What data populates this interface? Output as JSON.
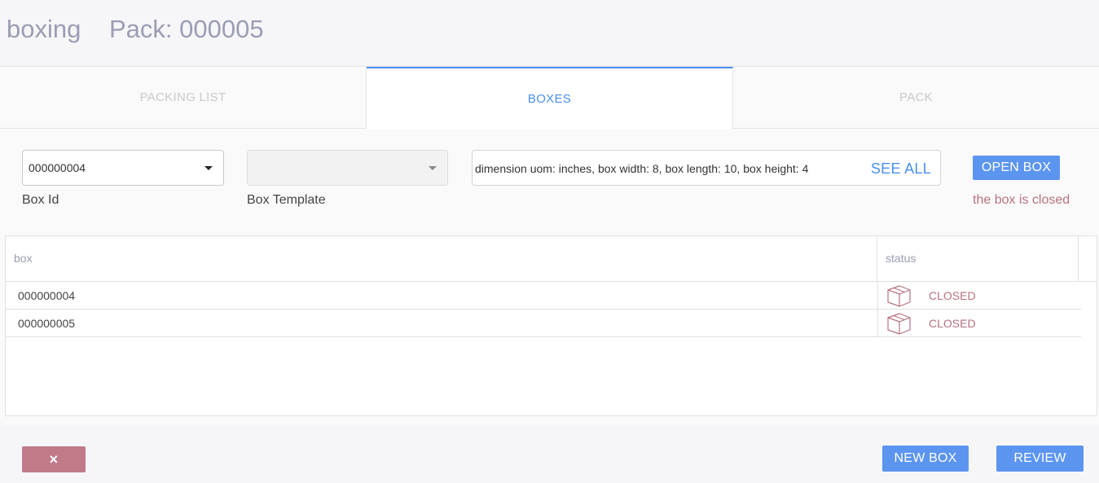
{
  "header": {
    "app_title": "boxing",
    "pack_title": "Pack: 000005"
  },
  "tabs": [
    {
      "label": "PACKING LIST",
      "active": false
    },
    {
      "label": "BOXES",
      "active": true
    },
    {
      "label": "PACK",
      "active": false
    }
  ],
  "form": {
    "box_id_value": "000000004",
    "box_id_label": "Box Id",
    "box_template_value": "",
    "box_template_label": "Box Template",
    "dimensions_text": "dimension uom: inches, box width: 8, box length: 10, box height: 4",
    "see_all_label": "SEE ALL",
    "open_box_label": "OPEN BOX",
    "box_status_message": "the box is closed"
  },
  "table": {
    "columns": [
      "box",
      "status"
    ],
    "rows": [
      {
        "box": "000000004",
        "status": "CLOSED",
        "icon": "box-icon"
      },
      {
        "box": "000000005",
        "status": "CLOSED",
        "icon": "box-icon"
      }
    ]
  },
  "footer": {
    "cancel_label": "×",
    "new_box_label": "NEW BOX",
    "review_label": "REVIEW"
  },
  "colors": {
    "accent": "#4a8ff0",
    "button_blue": "#5c95f0",
    "status_closed": "#b8717f",
    "cancel": "#c17a87"
  }
}
